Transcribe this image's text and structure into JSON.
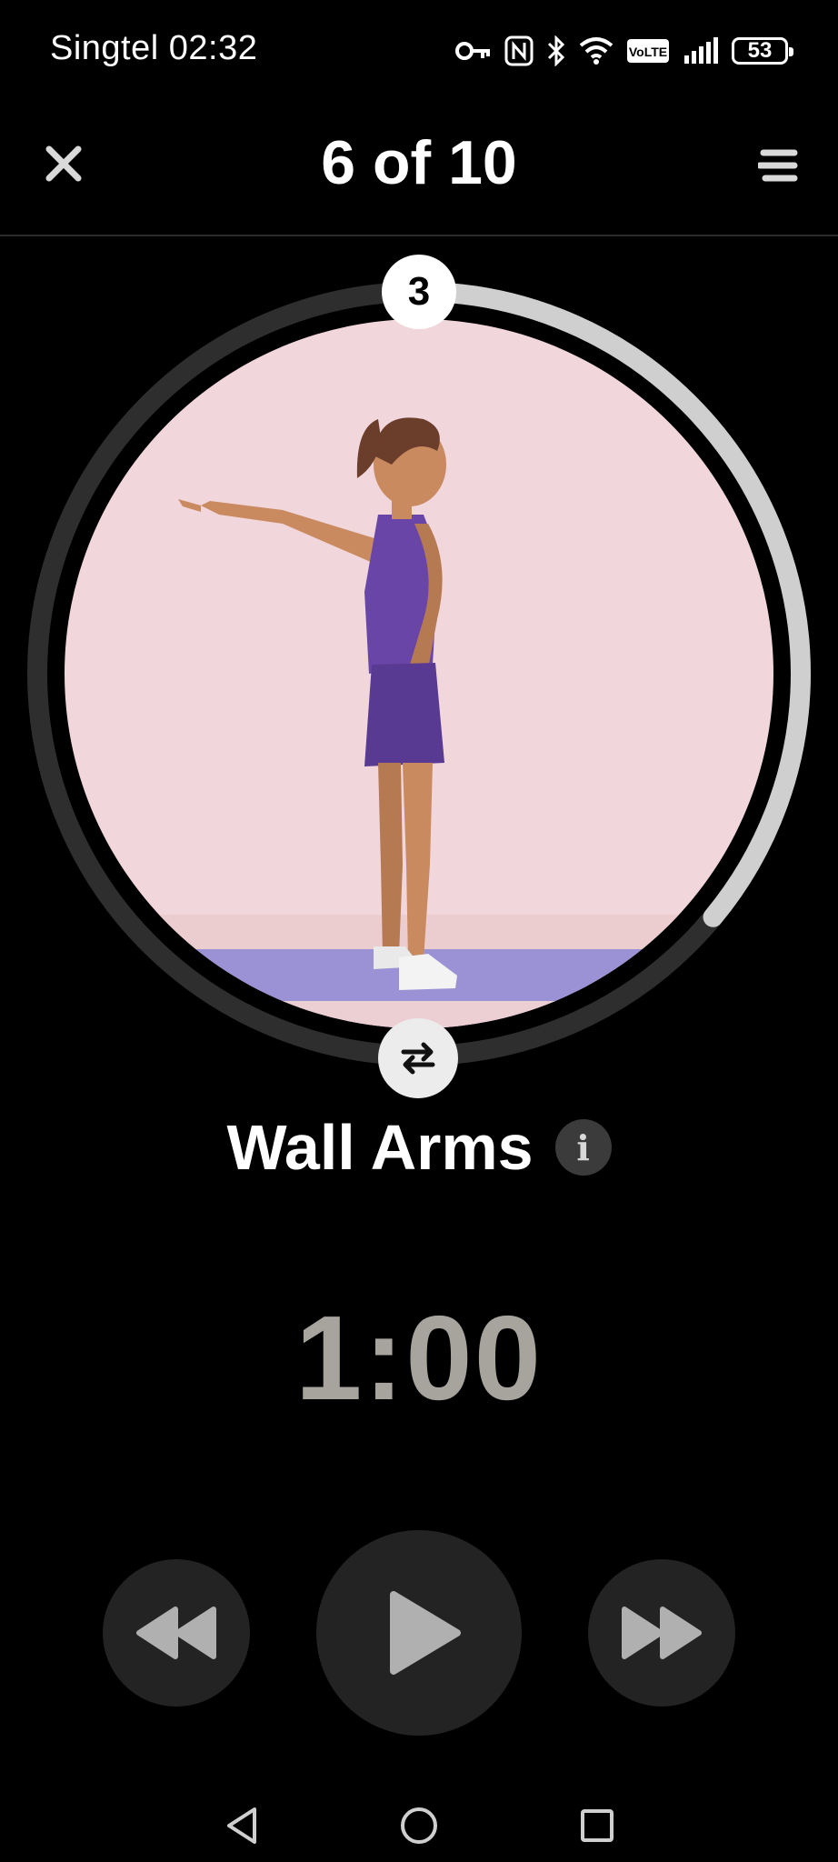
{
  "status_bar": {
    "carrier": "Singtel",
    "time": "02:32",
    "volte_label": "VoLTE",
    "battery_level": "53",
    "icons": [
      "key-icon",
      "nfc-icon",
      "bluetooth-icon",
      "wifi-icon",
      "volte-icon",
      "signal-icon",
      "battery-icon"
    ]
  },
  "header": {
    "progress": "6 of 10",
    "close_icon": "close-icon",
    "list_icon": "list-icon"
  },
  "exercise": {
    "set_number": "3",
    "ring_progress_fraction": 0.36,
    "name": "Wall Arms",
    "info_label": "i",
    "timer": "1:00",
    "swap_icon": "swap-arrows-icon"
  },
  "controls": {
    "rewind_icon": "rewind-icon",
    "play_icon": "play-icon",
    "forward_icon": "fast-forward-icon"
  },
  "nav": {
    "back_icon": "back-triangle-icon",
    "home_icon": "home-circle-icon",
    "recents_icon": "recents-square-icon"
  },
  "colors": {
    "background": "#000000",
    "ring_track": "#2e2e2e",
    "ring_progress": "#cfcfcf",
    "illustration_bg": "#f1d6dc",
    "mat": "#9b92d6",
    "outfit": "#6a45a8",
    "timer": "#a7a49e"
  }
}
